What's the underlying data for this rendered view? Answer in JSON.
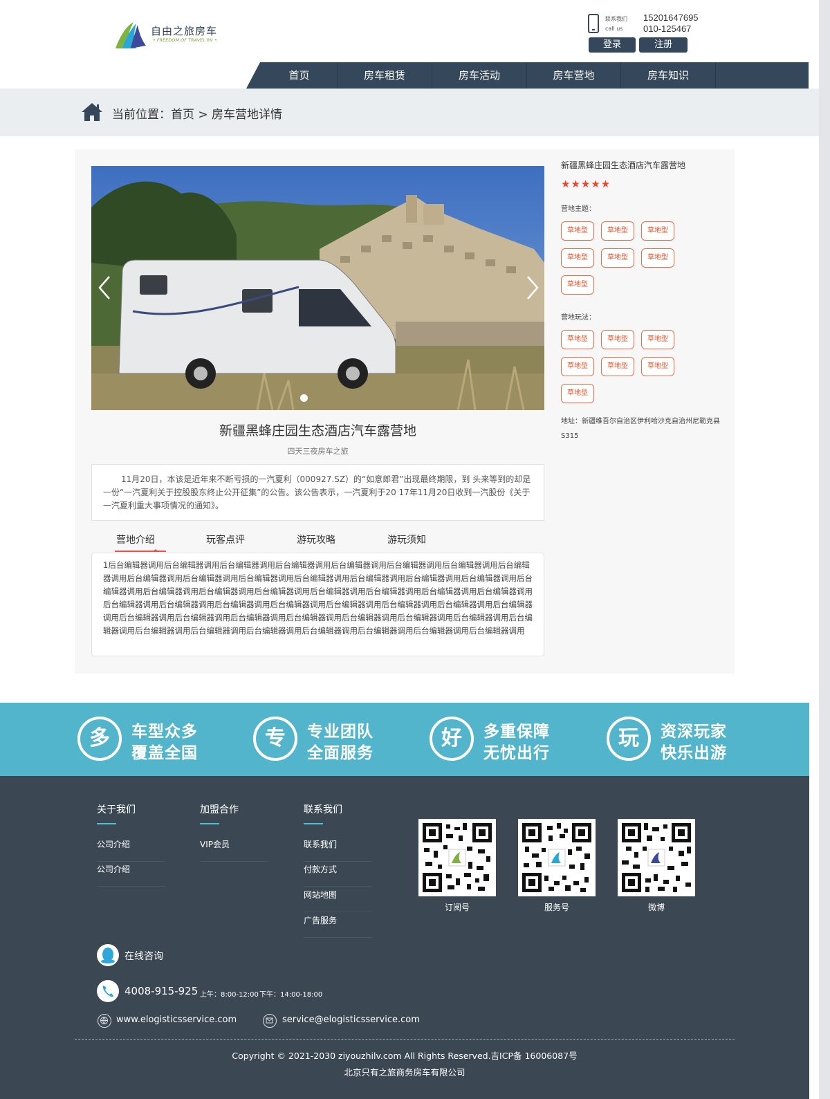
{
  "header": {
    "logo_name": "自由之旅房车",
    "logo_sub": "• FREEDOM OF TRAVEL RV •",
    "contact_label_cn": "联系我们",
    "contact_label_en": "call us",
    "phone1": "15201647695",
    "phone2": "010-125467",
    "login": "登录",
    "register": "注册"
  },
  "nav": [
    "首页",
    "房车租赁",
    "房车活动",
    "房车营地",
    "房车知识"
  ],
  "breadcrumb": "当前位置：首页 > 房车营地详情",
  "camp": {
    "title": "新疆黑蜂庄园生态酒店汽车露营地",
    "subtitle": "四天三夜房车之旅",
    "summary": "11月20日，本该是近年来不断亏损的一汽夏利（000927.SZ）的“如意郎君”出现最终期限，到 头来等到的却是一份“一汽夏利关于控股股东终止公开征集”的公告。该公告表示，一汽夏利于20 17年11月20日收到一汽股份《关于一汽夏利重大事项情况的通知》。",
    "tabs": [
      "营地介绍",
      "玩客点评",
      "游玩攻略",
      "游玩须知"
    ],
    "intro": "1后台编辑器调用后台编辑器调用后台编辑器调用后台编辑器调用后台编辑器调用后台编辑器调用后台编辑器调用后台编辑器调用后台编辑器调用后台编辑器调用后台编辑器调用后台编辑器调用后台编辑器调用后台编辑器调用后台编辑器调用后台编辑器调用后台编辑器调用后台编辑器调用后台编辑器调用后台编辑器调用后台编辑器调用后台编辑器调用后台编辑器调用后台编辑器调用后台编辑器调用后台编辑器调用后台编辑器调用后台编辑器调用后台编辑器调用后台编辑器调用后台编辑器调用后台编辑器调用后台编辑器调用后台编辑器调用后台编辑器调用后台编辑器调用后台编辑器调用后台编辑器调用后台编辑器调用后台编辑器调用后台编辑器调用后台编辑器调用后台编辑器调用后台编辑器调用后台编辑器调用后台编辑器调用"
  },
  "side": {
    "title": "新疆黑蜂庄园生态酒店汽车露营地",
    "stars": "★★★★★",
    "rating": 5,
    "theme_label": "营地主题：",
    "theme_tags": [
      "草地型",
      "草地型",
      "草地型",
      "草地型",
      "草地型",
      "草地型",
      "草地型"
    ],
    "play_label": "营地玩法：",
    "play_tags": [
      "草地型",
      "草地型",
      "草地型",
      "草地型",
      "草地型",
      "草地型",
      "草地型"
    ],
    "address": "地址：新疆维吾尔自治区伊利哈沙克自治州尼勒克县S315"
  },
  "features": [
    {
      "icon": "多",
      "line1": "车型众多",
      "line2": "覆盖全国"
    },
    {
      "icon": "专",
      "line1": "专业团队",
      "line2": "全面服务"
    },
    {
      "icon": "好",
      "line1": "多重保障",
      "line2": "无忧出行"
    },
    {
      "icon": "玩",
      "line1": "资深玩家",
      "line2": "快乐出游"
    }
  ],
  "footer": {
    "col1": {
      "heading": "关于我们",
      "links": [
        "公司介绍",
        "公司介绍"
      ]
    },
    "col2": {
      "heading": "加盟合作",
      "links": [
        "VIP会员"
      ]
    },
    "col3": {
      "heading": "联系我们",
      "links": [
        "联系我们",
        "付款方式",
        "网站地图",
        "广告服务"
      ]
    },
    "qr": [
      "订阅号",
      "服务号",
      "微博"
    ],
    "online": "在线咨询",
    "tel": "4008-915-925",
    "hours_am": "上午：8:00-12:00",
    "hours_pm": "下午：14:00-18:00",
    "website": "www.elogisticsservice.com",
    "email": "service@elogisticsservice.com",
    "copyright": "Copyright © 2021-2030 ziyouzhilv.com All Rights Reserved.吉ICP备 16006087号",
    "company": "北京只有之旅商务房车有限公司"
  },
  "colors": {
    "nav": "#35475a",
    "accent": "#e2554e",
    "tag": "#e96d45",
    "features_bg": "#52b5cc",
    "footer_bg": "#3b4752"
  }
}
